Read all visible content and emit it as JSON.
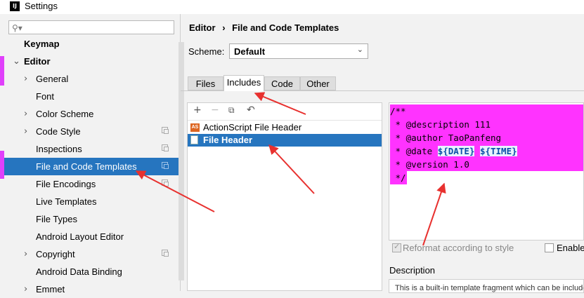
{
  "window": {
    "title": "Settings",
    "app_icon": "IJ"
  },
  "sidebar": {
    "search_placeholder": "",
    "items": [
      {
        "label": "Keymap"
      },
      {
        "label": "Editor"
      },
      {
        "label": "General"
      },
      {
        "label": "Font"
      },
      {
        "label": "Color Scheme"
      },
      {
        "label": "Code Style"
      },
      {
        "label": "Inspections"
      },
      {
        "label": "File and Code Templates"
      },
      {
        "label": "File Encodings"
      },
      {
        "label": "Live Templates"
      },
      {
        "label": "File Types"
      },
      {
        "label": "Android Layout Editor"
      },
      {
        "label": "Copyright"
      },
      {
        "label": "Android Data Binding"
      },
      {
        "label": "Emmet"
      }
    ]
  },
  "breadcrumb": {
    "parent": "Editor",
    "separator": "›",
    "current": "File and Code Templates"
  },
  "scheme": {
    "label": "Scheme:",
    "value": "Default"
  },
  "tabs": [
    {
      "label": "Files"
    },
    {
      "label": "Includes"
    },
    {
      "label": "Code"
    },
    {
      "label": "Other"
    }
  ],
  "templates": [
    {
      "label": "ActionScript File Header",
      "icon_text": "AS"
    },
    {
      "label": "File Header"
    }
  ],
  "editor": {
    "lines": [
      {
        "text": "/**"
      },
      {
        "text": " * @description 111"
      },
      {
        "text": " * @author TaoPanfeng"
      },
      {
        "pre": " * @date ",
        "var1": "${DATE}",
        "mid": " ",
        "var2": "${TIME}"
      },
      {
        "text": " * @version 1.0"
      },
      {
        "text": " */"
      }
    ]
  },
  "options": {
    "reformat_label": "Reformat according to style",
    "enable_label": "Enable"
  },
  "description": {
    "label": "Description",
    "text": "This is a built-in template fragment which can be included"
  },
  "colors": {
    "selection": "#2675bf",
    "highlight": "#ff33ff",
    "arrow": "#e8312f"
  }
}
